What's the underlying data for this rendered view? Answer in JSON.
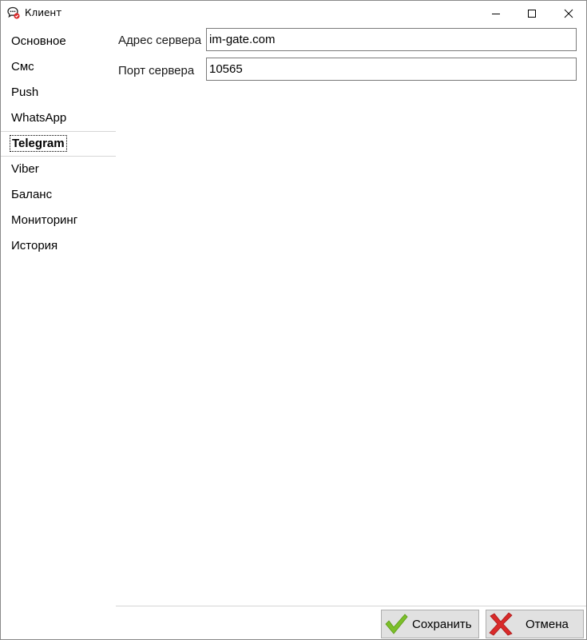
{
  "window": {
    "title": "Клиент"
  },
  "nav": {
    "items": [
      {
        "label": "Основное"
      },
      {
        "label": "Смс"
      },
      {
        "label": "Push"
      },
      {
        "label": "WhatsApp"
      },
      {
        "label": "Telegram",
        "selected": true
      },
      {
        "label": "Viber"
      },
      {
        "label": "Баланс"
      },
      {
        "label": "Мониторинг"
      },
      {
        "label": "История"
      }
    ]
  },
  "form": {
    "server_address_label": "Адрес сервера",
    "server_address_value": "im-gate.com",
    "server_port_label": "Порт сервера",
    "server_port_value": "10565"
  },
  "footer": {
    "save_label": "Сохранить",
    "cancel_label": "Отмена"
  },
  "colors": {
    "save_icon": "#7cbf2a",
    "cancel_icon": "#d92a2a",
    "window_border": "#8a8a8a",
    "button_face": "#e1e1e1"
  },
  "icons": {
    "app": "chat-bubble-icon",
    "save": "checkmark-icon",
    "cancel": "cross-icon"
  }
}
